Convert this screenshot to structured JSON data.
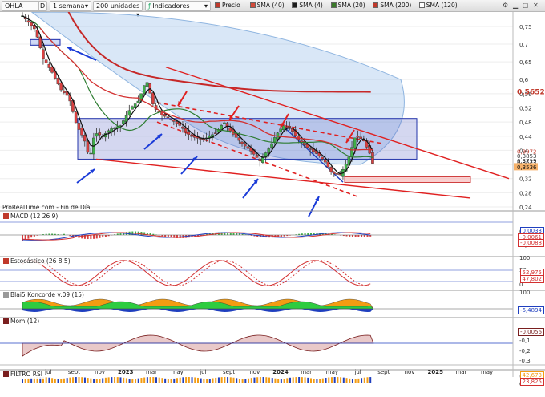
{
  "toolbar": {
    "symbol": "OHLA",
    "period_code": "D",
    "period": "1 semana",
    "units": "200 unidades",
    "indicators": "Indicadores",
    "legend": [
      {
        "label": "Precio",
        "color": "#c0392b"
      },
      {
        "label": "SMA (40)",
        "color": "#d24b3a"
      },
      {
        "label": "SMA (4)",
        "color": "#1b1b1b"
      },
      {
        "label": "SMA (20)",
        "color": "#3a7a2a"
      },
      {
        "label": "SMA (200)",
        "color": "#c0392b"
      },
      {
        "label": "SMA (120)",
        "color": "#ffffff"
      }
    ]
  },
  "source": "ProRealTime.com - Fin de Día",
  "panels": {
    "macd": {
      "title": "MACD (12 26 9)",
      "tag1": "0,0033",
      "tag2": "-0,0061",
      "tag3": "-0,0088"
    },
    "stoch": {
      "title": "Estocástico (26 8 5)",
      "tag1": "52,975",
      "tag2": "47,802"
    },
    "koncorde": {
      "title": "Blai5 Koncorde v.09 (15)",
      "tag1": "-6,4894"
    },
    "mom": {
      "title": "Mom (12)",
      "tag1": "-0,0056"
    },
    "rsi": {
      "title": "FILTRO RSI",
      "tag1": "42,673",
      "tag2": "23,825"
    }
  },
  "chart_data": {
    "type": "candlestick",
    "price_axis": {
      "ticks": [
        "0,75",
        "0,7",
        "0,65",
        "0,6",
        "0,56",
        "0,52",
        "0,48",
        "0,44",
        "0,4",
        "0,36",
        "0,32",
        "0,28",
        "0,24"
      ],
      "tick_values": [
        0.75,
        0.7,
        0.65,
        0.6,
        0.56,
        0.52,
        0.48,
        0.44,
        0.4,
        0.36,
        0.32,
        0.28,
        0.24
      ],
      "labels": [
        {
          "text": "0,5652",
          "value": 0.5652,
          "color": "#c0392b",
          "big": true
        },
        {
          "text": "0,3972",
          "value": 0.3972,
          "color": "#c0392b"
        },
        {
          "text": "0,3853",
          "value": 0.3853,
          "color": "#333333"
        },
        {
          "text": "0,3719",
          "value": 0.3719,
          "color": "#333333"
        },
        {
          "text": "0,3673",
          "value": 0.3673,
          "color": "#333333"
        },
        {
          "text": "0,3536",
          "value": 0.3536,
          "color": "#111111",
          "bg": "#f6b26b"
        }
      ]
    },
    "x_axis": [
      "may",
      "jul",
      "sept",
      "nov",
      "2023",
      "mar",
      "may",
      "jul",
      "sept",
      "nov",
      "2024",
      "mar",
      "may",
      "jul",
      "sept",
      "nov",
      "2025",
      "mar",
      "may"
    ],
    "x_axis_bold": [
      "2023",
      "2024",
      "2025"
    ],
    "indicator_ticks": {
      "macd": [
        "0",
        "-0,05"
      ],
      "stoch": [
        "100",
        "50",
        "0"
      ],
      "koncorde": [
        "100",
        "0"
      ],
      "mom": [
        "0",
        "-0,1",
        "-0,2",
        "-0,3"
      ],
      "rsi": [
        "50",
        "0"
      ]
    }
  }
}
